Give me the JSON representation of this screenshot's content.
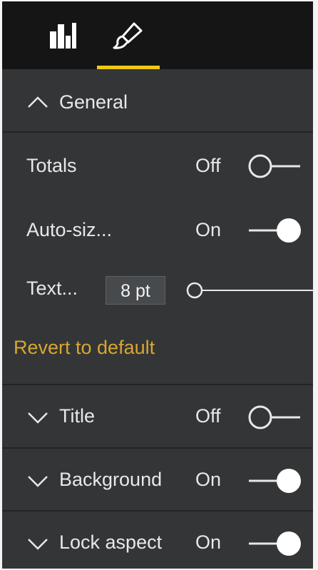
{
  "tabs": [
    {
      "icon": "bar-chart-icon",
      "label": ""
    },
    {
      "icon": "paintbrush-icon",
      "label": ""
    }
  ],
  "colors": {
    "panel_bg": "#333536",
    "topbar_bg": "#151515",
    "accent": "#f2c811",
    "revert_link": "#d9a631",
    "text": "#e8e8e8"
  },
  "general": {
    "header": "General",
    "expanded": true,
    "totals": {
      "label": "Totals",
      "state": "Off",
      "on": false
    },
    "autosize": {
      "label": "Auto-siz...",
      "state": "On",
      "on": true
    },
    "textsize": {
      "label": "Text...",
      "value": "8 pt",
      "slider_fraction": 0.0
    },
    "revert_label": "Revert to default"
  },
  "sections": [
    {
      "label": "Title",
      "state": "Off",
      "on": false
    },
    {
      "label": "Background",
      "state": "On",
      "on": true
    },
    {
      "label": "Lock aspect",
      "state": "On",
      "on": true
    }
  ]
}
